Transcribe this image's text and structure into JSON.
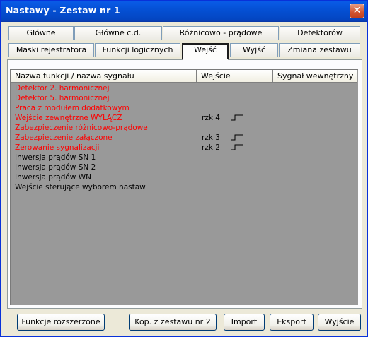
{
  "window": {
    "title": "Nastawy  -  Zestaw nr 1",
    "close_glyph": "✕"
  },
  "tabs_row1": [
    {
      "label": "Główne"
    },
    {
      "label": "Główne c.d."
    },
    {
      "label": "Różnicowo - prądowe"
    },
    {
      "label": "Detektorów"
    }
  ],
  "tabs_row2": [
    {
      "label": "Maski rejestratora"
    },
    {
      "label": "Funkcji logicznych"
    },
    {
      "label": "Wejść",
      "active": true
    },
    {
      "label": "Wyjść"
    },
    {
      "label": "Zmiana zestawu"
    }
  ],
  "list": {
    "columns": [
      "Nazwa funkcji / nazwa sygnału",
      "Wejście",
      "Sygnał wewnętrzny"
    ],
    "rows": [
      {
        "name": "Detektor 2. harmonicznej",
        "input": "",
        "color": "#ff0000"
      },
      {
        "name": "Detektor 5. harmonicznej",
        "input": "",
        "color": "#ff0000"
      },
      {
        "name": "Praca z modułem dodatkowym",
        "input": "",
        "color": "#ff0000"
      },
      {
        "name": "Wejście zewnętrzne WYŁĄCZ",
        "input": "rzk  4",
        "color": "#ff0000"
      },
      {
        "name": "Zabezpieczenie różnicowo-prądowe",
        "input": "",
        "color": "#ff0000"
      },
      {
        "name": "Zabezpieczenie załączone",
        "input": "rzk  3",
        "color": "#ff0000"
      },
      {
        "name": "Zerowanie sygnalizacji",
        "input": "rzk  2",
        "color": "#ff0000"
      },
      {
        "name": "Inwersja prądów SN 1",
        "input": "",
        "color": "#000000"
      },
      {
        "name": "Inwersja prądów SN 2",
        "input": "",
        "color": "#000000"
      },
      {
        "name": "Inwersja prądów WN",
        "input": "",
        "color": "#000000"
      },
      {
        "name": "Wejście sterujące wyborem nastaw",
        "input": "",
        "color": "#000000"
      }
    ]
  },
  "buttons": {
    "extended": "Funkcje rozszerzone",
    "copy": "Kop. z zestawu nr 2",
    "import": "Import",
    "export": "Eksport",
    "exit": "Wyjście"
  },
  "colors": {
    "title_bar": "#0551d6",
    "list_bg": "#999999",
    "active_signal": "#ff0000"
  }
}
